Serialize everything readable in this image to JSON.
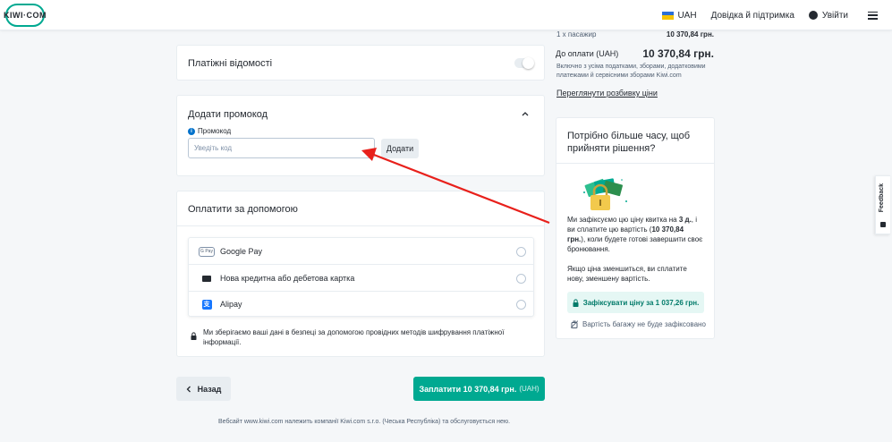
{
  "header": {
    "logo_text": "KIWI·COM",
    "currency": "UAH",
    "help_label": "Довідка й підтримка",
    "login_label": "Увійти"
  },
  "payment_details": {
    "title": "Платіжні відомості"
  },
  "promo": {
    "title": "Додати промокод",
    "field_label": "Промокод",
    "placeholder": "Уведіть код",
    "apply_label": "Додати"
  },
  "pay_with": {
    "title": "Оплатити за допомогою",
    "methods": [
      {
        "icon": "google-pay-icon",
        "label": "Google Pay"
      },
      {
        "icon": "credit-card-icon",
        "label": "Нова кредитна або дебетова картка"
      },
      {
        "icon": "alipay-icon",
        "label": "Alipay"
      }
    ],
    "security_note": "Ми зберігаємо ваші дані в безпеці за допомогою провідних методів шифрування платіжної інформації."
  },
  "actions": {
    "back_label": "Назад",
    "pay_label": "Заплатити 10 370,84 грн.",
    "pay_currency": "(UAH)"
  },
  "footer": {
    "text": "Вебсайт www.kiwi.com належить компанії Kiwi.com s.r.o. (Чеська Республіка) та обслуговується нею."
  },
  "summary": {
    "passengers_label": "1 x пасажир",
    "passengers_price": "10 370,84 грн.",
    "total_label": "До оплати (UAH)",
    "total_price": "10 370,84 грн.",
    "total_note": "Включно з усіма податками, зборами, додатковими платежами й сервісними зборами Kiwi.com",
    "breakdown_link": "Переглянути розбивку ціни"
  },
  "price_lock": {
    "title": "Потрібно більше часу, щоб прийняти рішення?",
    "desc_part1": "Ми зафіксуємо цю ціну квитка на ",
    "desc_days": "3 д.",
    "desc_part2": ", і ви сплатите цю вартість (",
    "desc_price": "10 370,84 грн.",
    "desc_part3": "), коли будете готові завершити своє бронювання.",
    "desc2": "Якщо ціна зменшиться, ви сплатите нову, зменшену вартість.",
    "button_label": "Зафіксувати ціну за 1 037,26 грн.",
    "baggage_note": "Вартість багажу не буде зафіксовано"
  },
  "feedback_label": "Feedback",
  "colors": {
    "accent": "#00a991",
    "arrow": "#e8201b",
    "link_blue": "#0172cb"
  }
}
